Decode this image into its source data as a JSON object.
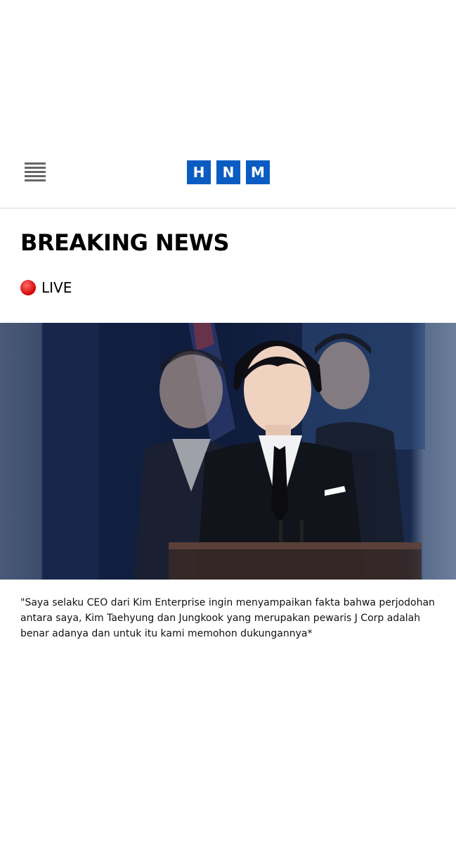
{
  "header": {
    "menu_icon": "hamburger-menu-icon",
    "logo_letters": [
      "H",
      "N",
      "M"
    ],
    "logo_color": "#0a5cc2"
  },
  "article": {
    "headline": "BREAKING NEWS",
    "live_label": "LIVE",
    "live_dot_color": "#e00000",
    "quote": "\"Saya selaku CEO dari Kim Enterprise ingin menyampaikan fakta bahwa perjodohan antara saya, Kim Taehyung dan Jungkook yang merupakan pewaris J Corp adalah benar adanya dan untuk itu kami memohon dukungannya*"
  }
}
